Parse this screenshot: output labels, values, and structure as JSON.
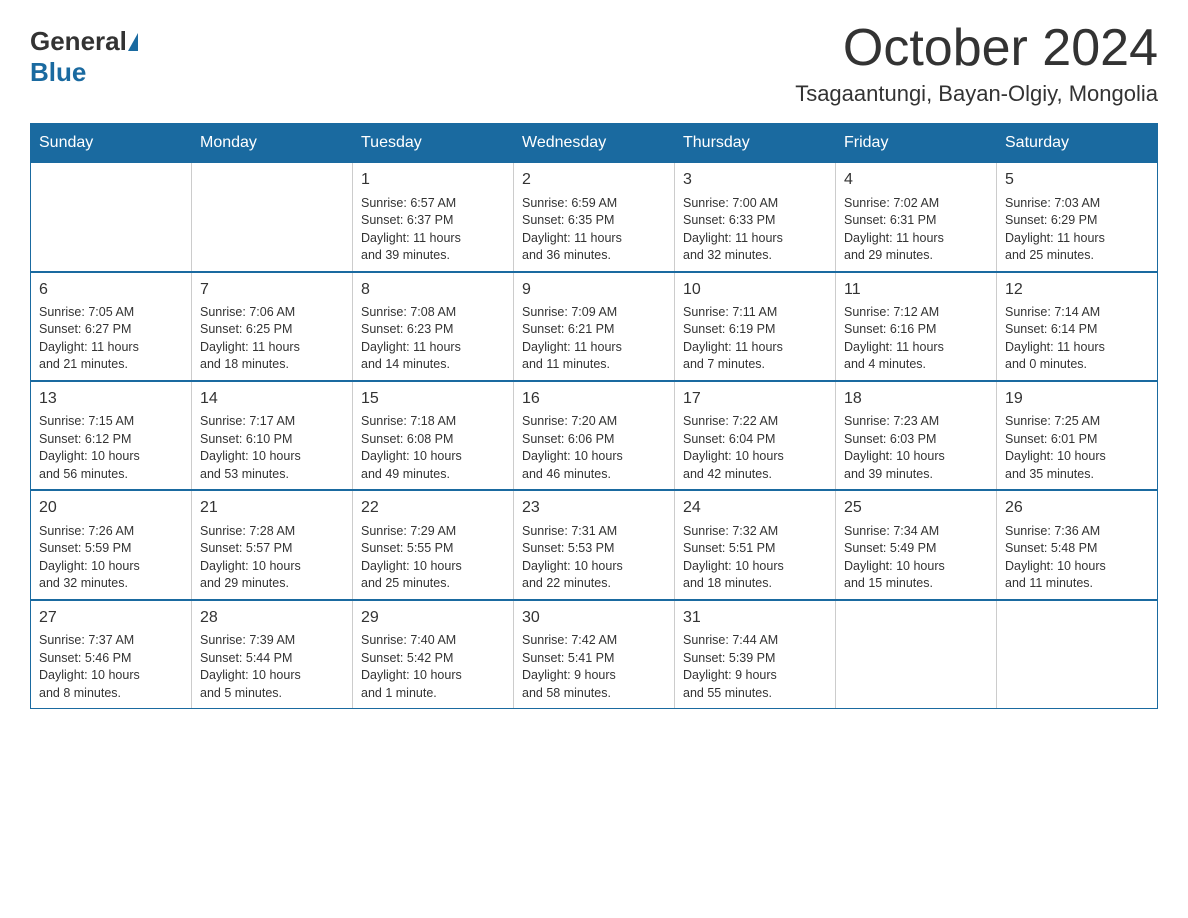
{
  "header": {
    "logo": {
      "part1": "General",
      "part2": "Blue"
    },
    "title": "October 2024",
    "location": "Tsagaantungi, Bayan-Olgiy, Mongolia"
  },
  "calendar": {
    "days_of_week": [
      "Sunday",
      "Monday",
      "Tuesday",
      "Wednesday",
      "Thursday",
      "Friday",
      "Saturday"
    ],
    "weeks": [
      [
        {
          "day": "",
          "info": ""
        },
        {
          "day": "",
          "info": ""
        },
        {
          "day": "1",
          "info": "Sunrise: 6:57 AM\nSunset: 6:37 PM\nDaylight: 11 hours\nand 39 minutes."
        },
        {
          "day": "2",
          "info": "Sunrise: 6:59 AM\nSunset: 6:35 PM\nDaylight: 11 hours\nand 36 minutes."
        },
        {
          "day": "3",
          "info": "Sunrise: 7:00 AM\nSunset: 6:33 PM\nDaylight: 11 hours\nand 32 minutes."
        },
        {
          "day": "4",
          "info": "Sunrise: 7:02 AM\nSunset: 6:31 PM\nDaylight: 11 hours\nand 29 minutes."
        },
        {
          "day": "5",
          "info": "Sunrise: 7:03 AM\nSunset: 6:29 PM\nDaylight: 11 hours\nand 25 minutes."
        }
      ],
      [
        {
          "day": "6",
          "info": "Sunrise: 7:05 AM\nSunset: 6:27 PM\nDaylight: 11 hours\nand 21 minutes."
        },
        {
          "day": "7",
          "info": "Sunrise: 7:06 AM\nSunset: 6:25 PM\nDaylight: 11 hours\nand 18 minutes."
        },
        {
          "day": "8",
          "info": "Sunrise: 7:08 AM\nSunset: 6:23 PM\nDaylight: 11 hours\nand 14 minutes."
        },
        {
          "day": "9",
          "info": "Sunrise: 7:09 AM\nSunset: 6:21 PM\nDaylight: 11 hours\nand 11 minutes."
        },
        {
          "day": "10",
          "info": "Sunrise: 7:11 AM\nSunset: 6:19 PM\nDaylight: 11 hours\nand 7 minutes."
        },
        {
          "day": "11",
          "info": "Sunrise: 7:12 AM\nSunset: 6:16 PM\nDaylight: 11 hours\nand 4 minutes."
        },
        {
          "day": "12",
          "info": "Sunrise: 7:14 AM\nSunset: 6:14 PM\nDaylight: 11 hours\nand 0 minutes."
        }
      ],
      [
        {
          "day": "13",
          "info": "Sunrise: 7:15 AM\nSunset: 6:12 PM\nDaylight: 10 hours\nand 56 minutes."
        },
        {
          "day": "14",
          "info": "Sunrise: 7:17 AM\nSunset: 6:10 PM\nDaylight: 10 hours\nand 53 minutes."
        },
        {
          "day": "15",
          "info": "Sunrise: 7:18 AM\nSunset: 6:08 PM\nDaylight: 10 hours\nand 49 minutes."
        },
        {
          "day": "16",
          "info": "Sunrise: 7:20 AM\nSunset: 6:06 PM\nDaylight: 10 hours\nand 46 minutes."
        },
        {
          "day": "17",
          "info": "Sunrise: 7:22 AM\nSunset: 6:04 PM\nDaylight: 10 hours\nand 42 minutes."
        },
        {
          "day": "18",
          "info": "Sunrise: 7:23 AM\nSunset: 6:03 PM\nDaylight: 10 hours\nand 39 minutes."
        },
        {
          "day": "19",
          "info": "Sunrise: 7:25 AM\nSunset: 6:01 PM\nDaylight: 10 hours\nand 35 minutes."
        }
      ],
      [
        {
          "day": "20",
          "info": "Sunrise: 7:26 AM\nSunset: 5:59 PM\nDaylight: 10 hours\nand 32 minutes."
        },
        {
          "day": "21",
          "info": "Sunrise: 7:28 AM\nSunset: 5:57 PM\nDaylight: 10 hours\nand 29 minutes."
        },
        {
          "day": "22",
          "info": "Sunrise: 7:29 AM\nSunset: 5:55 PM\nDaylight: 10 hours\nand 25 minutes."
        },
        {
          "day": "23",
          "info": "Sunrise: 7:31 AM\nSunset: 5:53 PM\nDaylight: 10 hours\nand 22 minutes."
        },
        {
          "day": "24",
          "info": "Sunrise: 7:32 AM\nSunset: 5:51 PM\nDaylight: 10 hours\nand 18 minutes."
        },
        {
          "day": "25",
          "info": "Sunrise: 7:34 AM\nSunset: 5:49 PM\nDaylight: 10 hours\nand 15 minutes."
        },
        {
          "day": "26",
          "info": "Sunrise: 7:36 AM\nSunset: 5:48 PM\nDaylight: 10 hours\nand 11 minutes."
        }
      ],
      [
        {
          "day": "27",
          "info": "Sunrise: 7:37 AM\nSunset: 5:46 PM\nDaylight: 10 hours\nand 8 minutes."
        },
        {
          "day": "28",
          "info": "Sunrise: 7:39 AM\nSunset: 5:44 PM\nDaylight: 10 hours\nand 5 minutes."
        },
        {
          "day": "29",
          "info": "Sunrise: 7:40 AM\nSunset: 5:42 PM\nDaylight: 10 hours\nand 1 minute."
        },
        {
          "day": "30",
          "info": "Sunrise: 7:42 AM\nSunset: 5:41 PM\nDaylight: 9 hours\nand 58 minutes."
        },
        {
          "day": "31",
          "info": "Sunrise: 7:44 AM\nSunset: 5:39 PM\nDaylight: 9 hours\nand 55 minutes."
        },
        {
          "day": "",
          "info": ""
        },
        {
          "day": "",
          "info": ""
        }
      ]
    ]
  }
}
